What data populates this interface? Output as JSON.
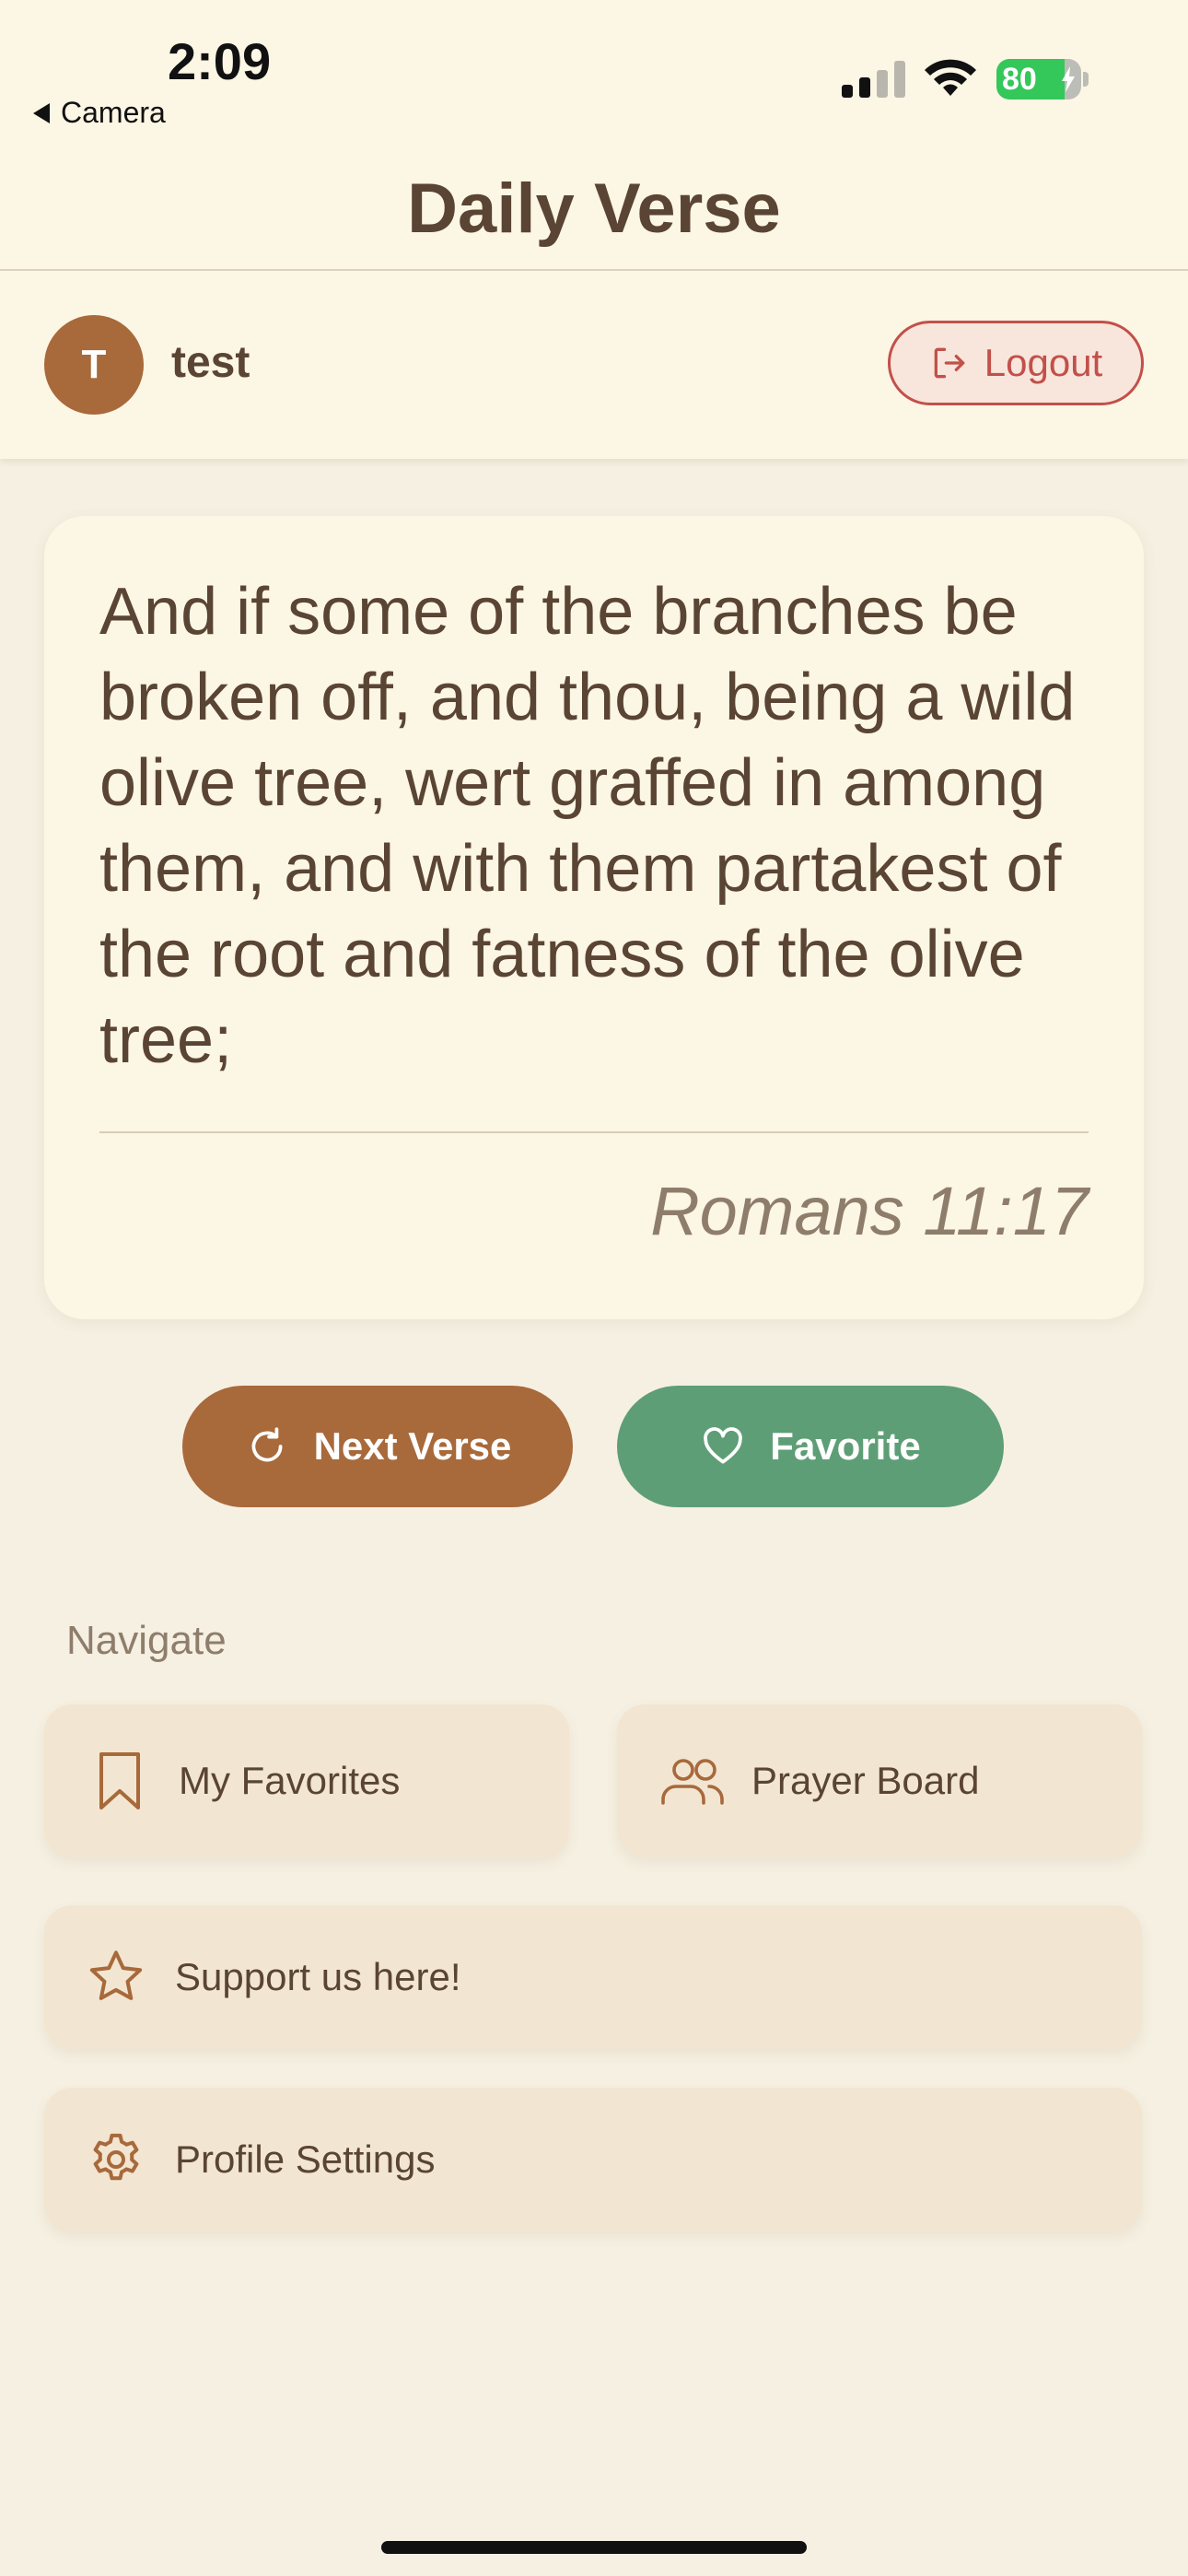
{
  "status_bar": {
    "time": "2:09",
    "back_label": "Camera",
    "battery_percent": "80",
    "battery_level": 0.8,
    "signal_bars": 2,
    "battery_color": "#34c759"
  },
  "header": {
    "title": "Daily Verse"
  },
  "user": {
    "avatar_initial": "T",
    "name": "test",
    "logout_label": "Logout"
  },
  "verse": {
    "text": "And if some of the branches be broken off, and thou, being a wild olive tree, wert graffed in among them, and with them partakest of the root and fatness of the olive tree;",
    "reference": "Romans 11:17"
  },
  "actions": {
    "next_label": "Next Verse",
    "favorite_label": "Favorite"
  },
  "navigate": {
    "heading": "Navigate",
    "favorites_label": "My Favorites",
    "prayer_label": "Prayer Board",
    "support_label": "Support us here!",
    "profile_label": "Profile Settings"
  },
  "colors": {
    "background": "#f6f0e2",
    "surface": "#fcf6e4",
    "primary_brown": "#a8693b",
    "favorite_green": "#5e9e76",
    "logout_red": "#c2504a",
    "text": "#5a4433",
    "muted_text": "#8f7d6c"
  },
  "icons": {
    "back": "back-triangle-icon",
    "next": "refresh-icon",
    "favorite": "heart-icon",
    "logout": "logout-icon",
    "favorites": "bookmark-icon",
    "prayer": "users-icon",
    "support": "star-icon",
    "profile": "gear-icon"
  }
}
